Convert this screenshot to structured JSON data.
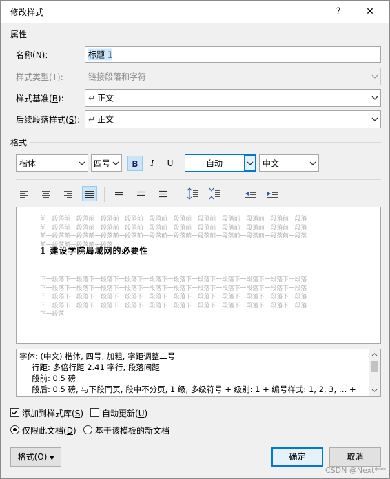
{
  "window": {
    "title": "修改样式",
    "help": "?",
    "close": "✕"
  },
  "properties": {
    "group_label": "属性",
    "name": {
      "label": "名称(",
      "key": "N",
      "end": "):",
      "value": "标题 1"
    },
    "style_type": {
      "label": "样式类型(T):",
      "value": "链接段落和字符"
    },
    "based_on": {
      "label": "样式基准(",
      "key": "B",
      "end": "):",
      "value": "正文",
      "mark": "↵"
    },
    "following": {
      "label": "后续段落样式(",
      "key": "S",
      "end": "):",
      "value": "正文",
      "mark": "↵"
    }
  },
  "format": {
    "group_label": "格式",
    "font": "楷体",
    "size": "四号",
    "bold": "B",
    "italic": "I",
    "underline": "U",
    "color": "自动",
    "script": "中文"
  },
  "preview": {
    "prev_paragraph": [
      "前一段落前一段落前一段落前一段落前一段落前一段落前一段落前一段落前一段落前一段落前一段落",
      "前一段落前一段落前一段落前一段落前一段落前一段落前一段落前一段落前一段落前一段落前一段落",
      "前一段落前一段落前一段落前一段落前一段落前一段落前一段落前一段落前一段落前一段落前一段落",
      "前一段落前一段落前一段落"
    ],
    "heading": "1 建设学院局域网的必要性",
    "next_paragraph": [
      "下一段落下一段落下一段落下一段落下一段落下一段落下一段落下一段落下一段落下一段落下一段落",
      "下一段落下一段落下一段落下一段落下一段落下一段落下一段落下一段落下一段落下一段落下一段落",
      "下一段落下一段落下一段落下一段落下一段落下一段落下一段落下一段落下一段落下一段落下一段落",
      "下一段落下一段落下一段落下一段落下一段落下一段落下一段落下一段落下一段落下一段落下一段落",
      "下一段落"
    ]
  },
  "description": {
    "lines": [
      "字体: (中文) 楷体, 四号, 加粗, 字距调整二号",
      "行距: 多倍行距 2.41 字行, 段落间距",
      "段前: 0.5 磅",
      "段后: 0.5 磅, 与下段同页, 段中不分页, 1 级, 多级符号 + 级别: 1 + 编号样式: 1, 2, 3, … +"
    ]
  },
  "options": {
    "add_to_gallery": {
      "label": "添加到样式库(",
      "key": "S",
      "end": ")",
      "checked": true
    },
    "auto_update": {
      "label": "自动更新(",
      "key": "U",
      "end": ")",
      "checked": false
    },
    "only_this_doc": {
      "label": "仅限此文档(",
      "key": "D",
      "end": ")",
      "selected": true
    },
    "new_docs": {
      "label": "基于该模板的新文档",
      "selected": false
    }
  },
  "buttons": {
    "format": "格式(O)",
    "ok": "确定",
    "cancel": "取消"
  },
  "watermark": "CSDN @Next***",
  "colors": {
    "accent": "#0078d7",
    "selection": "#cce8ff",
    "active_toggle": "#cce4f7"
  }
}
